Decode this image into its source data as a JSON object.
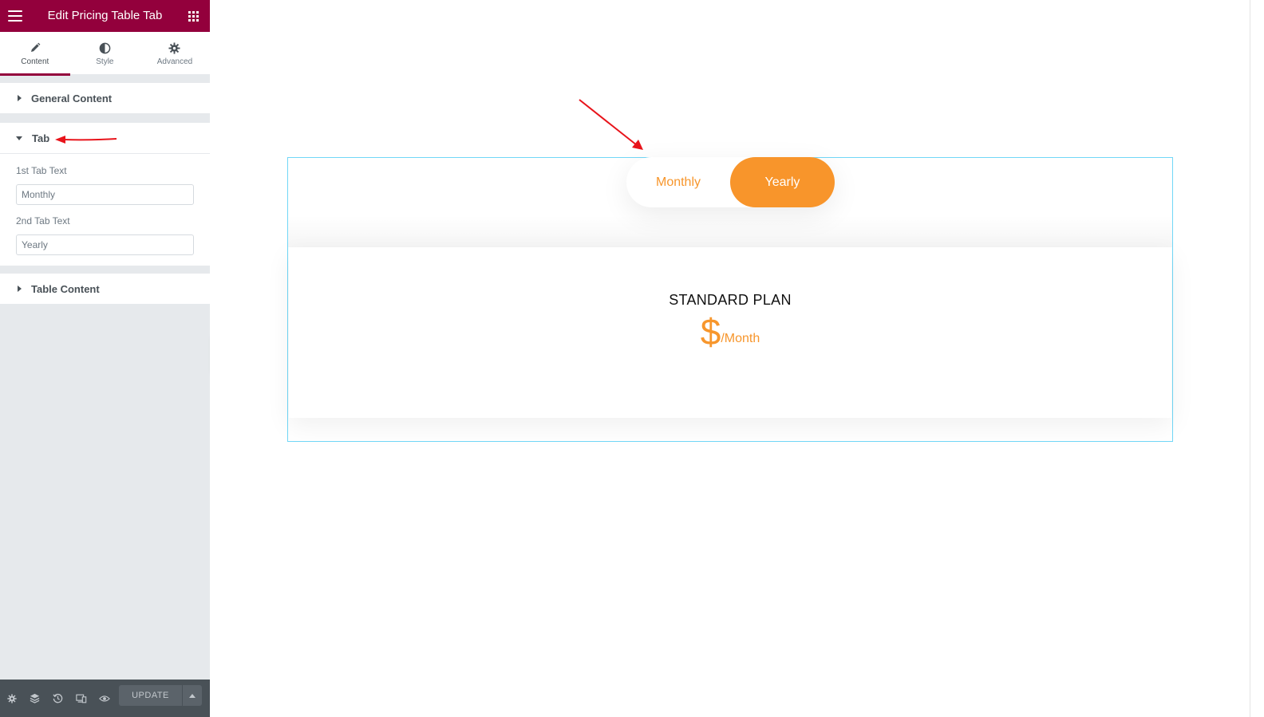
{
  "panel": {
    "title": "Edit Pricing Table Tab",
    "tabs": [
      {
        "label": "Content",
        "icon": "pencil-icon",
        "active": true
      },
      {
        "label": "Style",
        "icon": "contrast-icon",
        "active": false
      },
      {
        "label": "Advanced",
        "icon": "gear-icon",
        "active": false
      }
    ],
    "sections": {
      "general": {
        "title": "General Content"
      },
      "tab": {
        "title": "Tab",
        "first_label": "1st Tab Text",
        "first_value": "Monthly",
        "second_label": "2nd Tab Text",
        "second_value": "Yearly"
      },
      "table": {
        "title": "Table Content"
      }
    },
    "footer": {
      "icons": [
        "settings-icon",
        "layers-icon",
        "history-icon",
        "responsive-icon",
        "preview-icon"
      ],
      "update_label": "UPDATE"
    }
  },
  "canvas": {
    "toggle": {
      "monthly": "Monthly",
      "yearly": "Yearly",
      "active": "yearly"
    },
    "plan": {
      "title": "STANDARD PLAN",
      "currency": "$",
      "period": "/Month"
    }
  },
  "colors": {
    "brand": "#93003c",
    "accent": "#f8952b",
    "frame": "#71d7f7",
    "annotation": "#e8141b"
  }
}
